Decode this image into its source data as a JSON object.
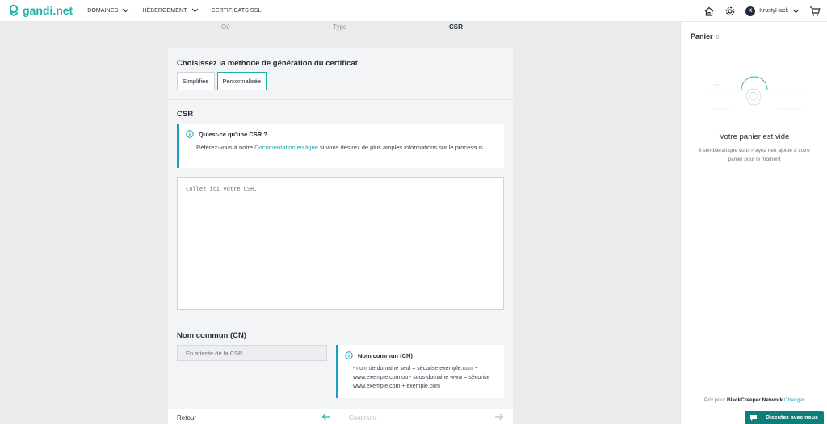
{
  "header": {
    "logo_text": "gandi.net",
    "nav": [
      {
        "label": "DOMAINES"
      },
      {
        "label": "HÉBERGEMENT"
      },
      {
        "label": "CERTIFICATS SSL"
      }
    ],
    "username": "KrustyHack",
    "avatar_initial": "K",
    "icons": [
      "home-icon",
      "gear-icon",
      "cart-icon"
    ]
  },
  "steps": [
    {
      "label": "Où"
    },
    {
      "label": "Type"
    },
    {
      "label": "CSR",
      "active": true
    }
  ],
  "method": {
    "title": "Choisissez la méthode de génération du certificat",
    "options": [
      {
        "label": "Simplifiée",
        "selected": false
      },
      {
        "label": "Personnalisée",
        "selected": true
      }
    ]
  },
  "csr": {
    "title": "CSR",
    "info_title": "Qu'est-ce qu'une CSR ?",
    "info_prefix": "Référez-vous à notre ",
    "info_link": "Documentation en ligne",
    "info_suffix": " si vous désirez de plus amples informations sur le processus.",
    "placeholder": "Collez ici votre CSR."
  },
  "cn": {
    "title": "Nom commun (CN)",
    "placeholder": "En attente de la CSR...",
    "info_title": "Nom commun (CN)",
    "info_body": "- nom de domaine seul = sécurise exemple.com + www.exemple.com ou - sous-domaine www = sécurise www.exemple.com + exemple.com"
  },
  "footer": {
    "back_label": "Retour",
    "next_label": "Continuer"
  },
  "cart": {
    "title": "Panier",
    "count": "0",
    "empty_title": "Votre panier est vide",
    "empty_sub": "Il semblerait que vous n'ayez rien ajouté à votre panier pour le moment",
    "price_prefix": "Prix pour ",
    "org": "BlackCreeper Network",
    "change_label": "Changer"
  },
  "chat": {
    "label": "Discutez avec nous"
  },
  "colors": {
    "brand": "#1bb3a8",
    "info_border": "#1b9cc4",
    "chat_bg": "#0c7f7a"
  }
}
